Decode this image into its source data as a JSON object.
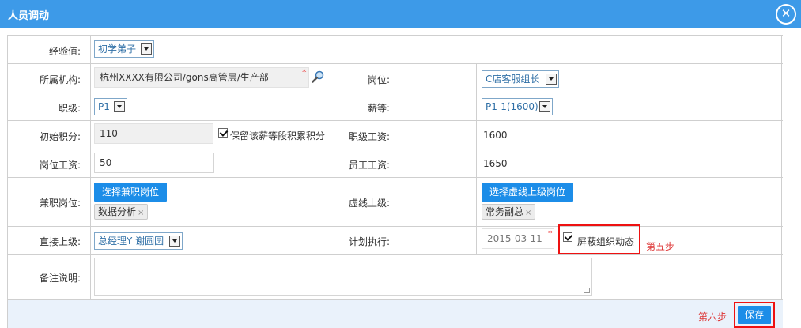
{
  "window": {
    "title": "人员调动",
    "close_icon": "close-icon"
  },
  "form": {
    "experience": {
      "label": "经验值:",
      "value": "初学弟子"
    },
    "org": {
      "label": "所属机构:",
      "value": "杭州XXXX有限公司/gons高管层/生产部",
      "required": "*"
    },
    "position": {
      "label": "岗位:",
      "value": "C店客服组长"
    },
    "rank": {
      "label": "职级:",
      "value": "P1"
    },
    "pay_grade": {
      "label": "薪等:",
      "value": "P1-1(1600)"
    },
    "initial_points": {
      "label": "初始积分:",
      "value": "110",
      "checkbox_label": "保留该薪等段积累积分",
      "checked": true
    },
    "rank_salary": {
      "label": "职级工资:",
      "value": "1600"
    },
    "position_salary": {
      "label": "岗位工资:",
      "value": "50"
    },
    "employee_salary": {
      "label": "员工工资:",
      "value": "1650"
    },
    "part_time_position": {
      "label": "兼职岗位:",
      "button": "选择兼职岗位",
      "tag": "数据分析",
      "tag_remove": "×"
    },
    "dotted_line_superior": {
      "label": "虚线上级:",
      "button": "选择虚线上级岗位",
      "tag": "常务副总",
      "tag_remove": "×"
    },
    "direct_superior": {
      "label": "直接上级:",
      "value": "总经理Y 谢圆圆"
    },
    "plan_execution": {
      "label": "计划执行:",
      "value": "2015-03-11",
      "required": "*",
      "checkbox_label": "屏蔽组织动态",
      "checked": true,
      "step": "第五步"
    },
    "remarks": {
      "label": "备注说明:",
      "value": ""
    }
  },
  "footer": {
    "step": "第六步",
    "save_label": "保存"
  },
  "colors": {
    "titlebar": "#3d9ae8",
    "button": "#1c8de8",
    "highlight": "#ee1111"
  }
}
